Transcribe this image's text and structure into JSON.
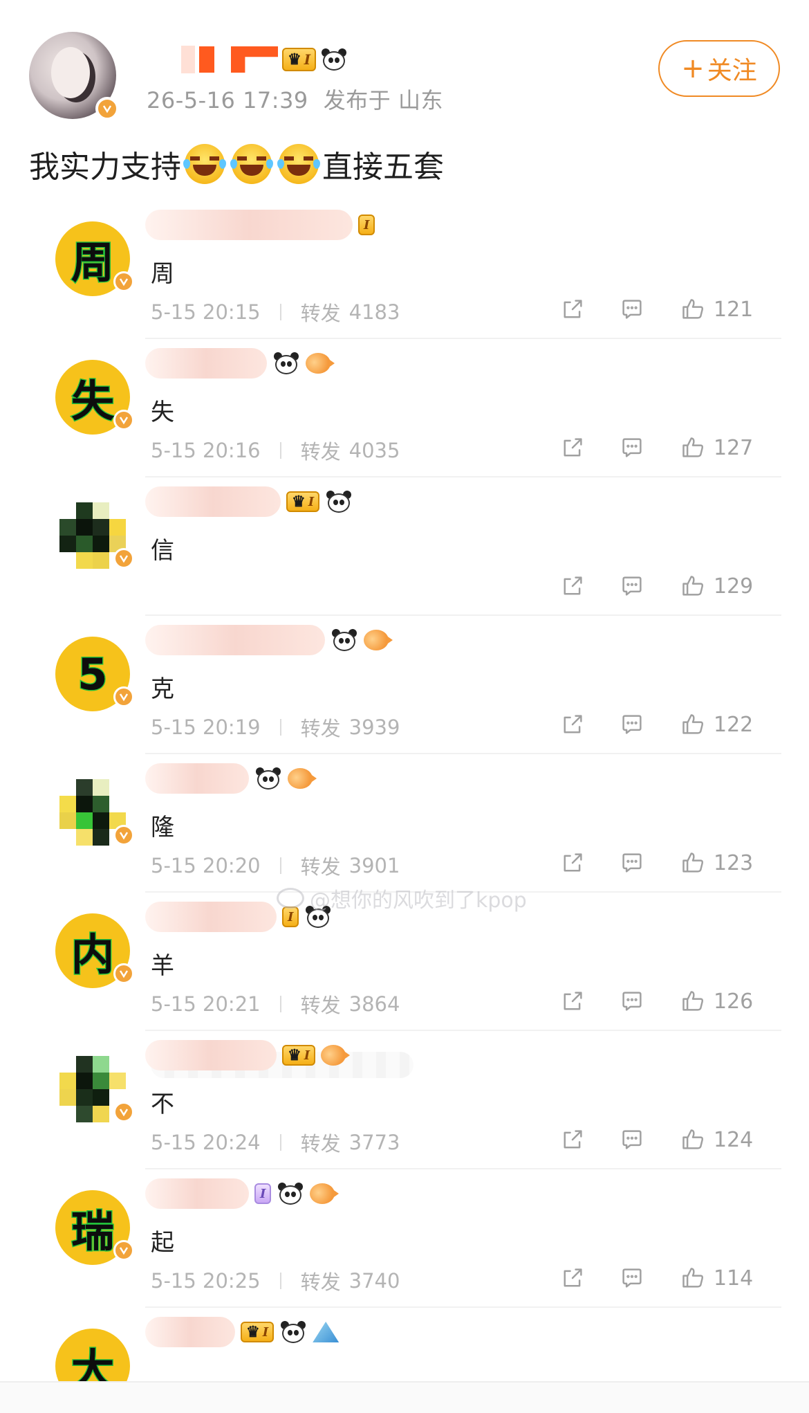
{
  "post": {
    "time": "26-5-16 17:39",
    "location": "发布于 山东",
    "text_before": "我实力支持",
    "text_after": "直接五套",
    "level": "I",
    "follow_label": "关注",
    "follow_plus": "+"
  },
  "reposts": [
    {
      "avatar_char": "周",
      "text": "周",
      "time": "5-15 20:15",
      "forward_label": "转发",
      "forward_count": "4183",
      "likes": "121"
    },
    {
      "avatar_char": "失",
      "text": "失",
      "time": "5-15 20:16",
      "forward_label": "转发",
      "forward_count": "4035",
      "likes": "127"
    },
    {
      "avatar_char": "",
      "text": "信",
      "time": "",
      "forward_label": "",
      "forward_count": "",
      "likes": "129"
    },
    {
      "avatar_char": "5",
      "text": "克",
      "time": "5-15 20:19",
      "forward_label": "转发",
      "forward_count": "3939",
      "likes": "122"
    },
    {
      "avatar_char": "",
      "text": "隆",
      "time": "5-15 20:20",
      "forward_label": "转发",
      "forward_count": "3901",
      "likes": "123"
    },
    {
      "avatar_char": "内",
      "text": "羊",
      "time": "5-15 20:21",
      "forward_label": "转发",
      "forward_count": "3864",
      "likes": "126"
    },
    {
      "avatar_char": "",
      "text": "不",
      "time": "5-15 20:24",
      "forward_label": "转发",
      "forward_count": "3773",
      "likes": "124"
    },
    {
      "avatar_char": "瑞",
      "text": "起",
      "time": "5-15 20:25",
      "forward_label": "转发",
      "forward_count": "3740",
      "likes": "114"
    },
    {
      "avatar_char": "大",
      "text": "",
      "time": "",
      "forward_label": "",
      "forward_count": "",
      "likes": ""
    }
  ],
  "watermark": "@想你的风吹到了kpop",
  "colors": {
    "accent": "#f08a24",
    "avatar_yellow": "#f6c21b",
    "meta_gray": "#b4b4b4"
  }
}
